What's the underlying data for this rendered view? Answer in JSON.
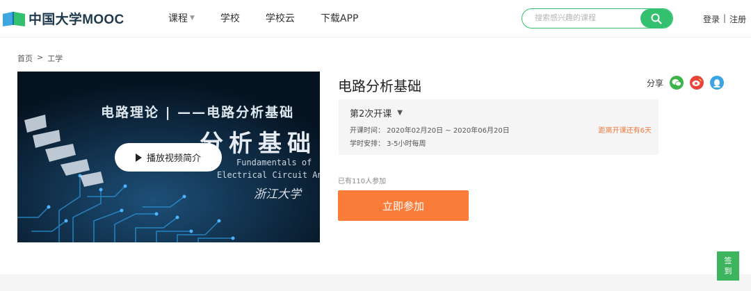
{
  "header": {
    "logo_text": "中国大学MOOC",
    "nav": [
      {
        "label": "课程",
        "has_dropdown": true
      },
      {
        "label": "学校",
        "has_dropdown": false
      },
      {
        "label": "学校云",
        "has_dropdown": false
      },
      {
        "label": "下载APP",
        "has_dropdown": false
      }
    ],
    "search_placeholder": "搜索感兴趣的课程",
    "login": "登录",
    "separator": "|",
    "register": "注册"
  },
  "breadcrumb": {
    "home": "首页",
    "separator": ">",
    "category": "工学"
  },
  "video": {
    "title_line": "电路理论 | ——电路分析基础",
    "big_text": "分析基础",
    "en_line1": "Fundamentals of",
    "en_line2": "Electrical Circuit Analysis",
    "university": "浙江大学",
    "play_label": "播放视频简介"
  },
  "course": {
    "title": "电路分析基础",
    "share_label": "分享",
    "term": "第2次开课",
    "time_text": "开课时间： 2020年02月20日 ~ 2020年06月20日",
    "schedule_text": "学时安排： 3-5小时每周",
    "countdown": "距离开课还有6天",
    "enrolled": "已有110人参加",
    "join_label": "立即参加"
  },
  "signin": {
    "line1": "签",
    "line2": "到"
  },
  "colors": {
    "brand_green": "#33c06f",
    "join_orange": "#fa7c38",
    "countdown_orange": "#f0793e",
    "signin_green": "#3db55f"
  }
}
